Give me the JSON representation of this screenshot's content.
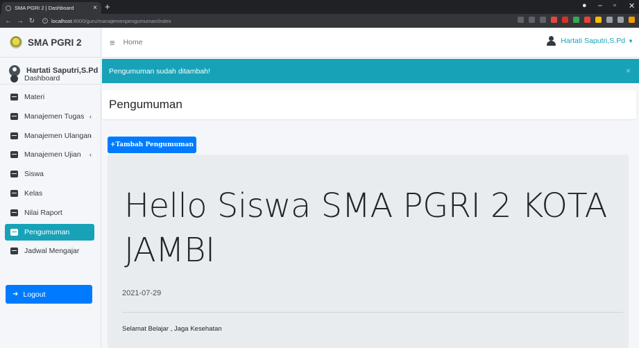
{
  "browser": {
    "tab_title": "SMA PGRI 2 | Dashboard",
    "tab_close": "×",
    "new_tab": "+",
    "url_host": "localhost",
    "url_rest": ":8000/guru/manajemenpengumuman/index"
  },
  "brand": {
    "name": "SMA PGRI 2"
  },
  "user_panel": {
    "name": "Hartati Saputri,S.Pd"
  },
  "sidebar": {
    "items": [
      {
        "label": "Dashboard",
        "icon": "dashboard-icon"
      },
      {
        "label": "Materi",
        "icon": "book-icon"
      },
      {
        "label": "Manajemen Tugas",
        "icon": "book-icon",
        "chevron": "‹"
      },
      {
        "label": "Manajemen Ulangan",
        "icon": "book-icon",
        "chevron": "‹"
      },
      {
        "label": "Manajemen Ujian",
        "icon": "book-icon",
        "chevron": "‹"
      },
      {
        "label": "Siswa",
        "icon": "book-icon"
      },
      {
        "label": "Kelas",
        "icon": "book-icon"
      },
      {
        "label": "Nilai Raport",
        "icon": "book-icon"
      },
      {
        "label": "Pengumuman",
        "icon": "book-icon",
        "active": true
      },
      {
        "label": "Jadwal Mengajar",
        "icon": "book-icon"
      }
    ],
    "logout_label": "Logout"
  },
  "topnav": {
    "home_label": "Home",
    "user_label": "Hartati Saputri,S.Pd"
  },
  "alert": {
    "message": "Pengumuman sudah ditambah!",
    "close": "×"
  },
  "page": {
    "title": "Pengumuman",
    "add_button": "+Tambah Pengumuman"
  },
  "announcement": {
    "title": "Hello Siswa SMA PGRI 2 KOTA JAMBI",
    "date": "2021-07-29",
    "body": "Selamat Belajar , Jaga Kesehatan"
  },
  "colors": {
    "primary": "#007bff",
    "info": "#17a2b8",
    "jumbotron": "#e9ecef"
  }
}
